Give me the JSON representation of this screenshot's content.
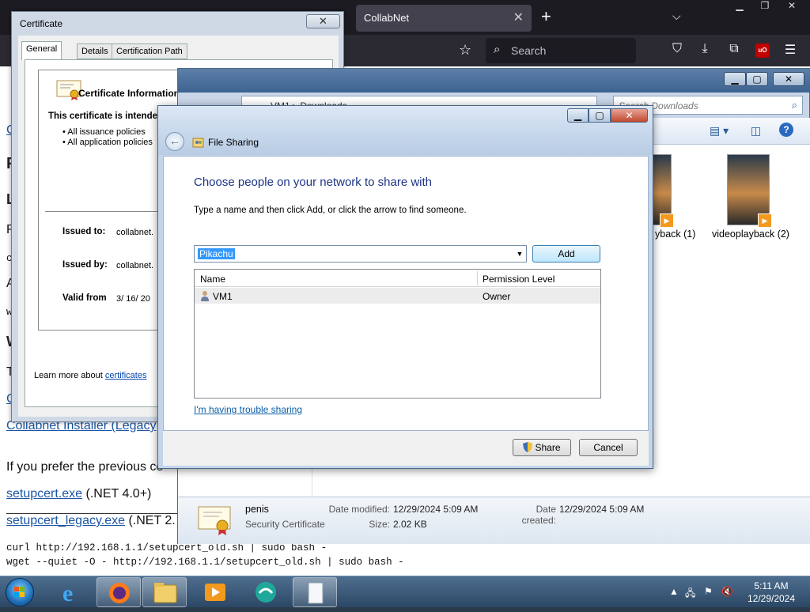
{
  "firefox": {
    "tab_title": "CollabNet",
    "search_placeholder": "Search",
    "toolbar_icons": [
      "pocket-icon",
      "download-icon",
      "extensions-icon",
      "ublock-icon",
      "menu-icon"
    ],
    "ublock_label": "uO"
  },
  "page": {
    "frag_c1": "C",
    "frag_p": "P",
    "frag_l": "L",
    "frag_r": "R",
    "frag_c2": "c",
    "frag_a": "A",
    "frag_w1": "w",
    "frag_w2": "W",
    "frag_t": "T",
    "frag_c3": "C",
    "installer_link": "Collabnet Installer (Legacy",
    "prefer_text": "If you prefer the previous ce",
    "setupcert_link": "setupcert.exe",
    "setupcert_suffix": "(.NET 4.0+)",
    "setupcert_legacy_link": "setupcert_legacy.exe",
    "setupcert_legacy_suffix": "(.NET 2.",
    "curl_cmd": "curl http://192.168.1.1/setupcert_old.sh | sudo bash -",
    "wget_cmd": "wget --quiet -O - http://192.168.1.1/setupcert_old.sh | sudo bash -"
  },
  "certificate": {
    "window_title": "Certificate",
    "close_glyph": "✕",
    "tabs": [
      "General",
      "Details",
      "Certification Path"
    ],
    "info_title": "Certificate Information",
    "intended": "This certificate is intende",
    "bullets": [
      "• All issuance policies",
      "• All application policies"
    ],
    "issued_to_label": "Issued to:",
    "issued_to_value": "collabnet.",
    "issued_by_label": "Issued by:",
    "issued_by_value": "collabnet.",
    "valid_from_label": "Valid from",
    "valid_from_value": "3/ 16/ 20",
    "learn_more_prefix": "Learn more about ",
    "learn_more_link": "certificates"
  },
  "explorer": {
    "address_path": "VM1 ▸ Downloads",
    "search_placeholder": "Search Downloads",
    "items": [
      {
        "label": "yback (1)"
      },
      {
        "label": "videoplayback (2)"
      }
    ],
    "details": {
      "name": "penis",
      "type": "Security Certificate",
      "date_modified_label": "Date modified:",
      "date_modified": "12/29/2024 5:09 AM",
      "size_label": "Size:",
      "size": "2.02 KB",
      "date_created_label": "Date created:",
      "date_created": "12/29/2024 5:09 AM"
    }
  },
  "file_sharing": {
    "title": "File Sharing",
    "heading": "Choose people on your network to share with",
    "instruction": "Type a name and then click Add, or click the arrow to find someone.",
    "input_value": "Pikachu",
    "add_label": "Add",
    "col_name": "Name",
    "col_permission": "Permission Level",
    "rows": [
      {
        "name": "VM1",
        "permission": "Owner"
      }
    ],
    "trouble_link": "I'm having trouble sharing",
    "share_label": "Share",
    "cancel_label": "Cancel"
  },
  "taskbar": {
    "time": "5:11 AM",
    "date": "12/29/2024",
    "apps": [
      "internet-explorer",
      "firefox",
      "file-explorer",
      "media-player",
      "messenger",
      "blank-document"
    ]
  },
  "colors": {
    "win7_glass": "#c4d5ea",
    "link_blue": "#0a5fa8",
    "heading_blue": "#1e3287",
    "firefox_dark": "#1c1b22"
  }
}
